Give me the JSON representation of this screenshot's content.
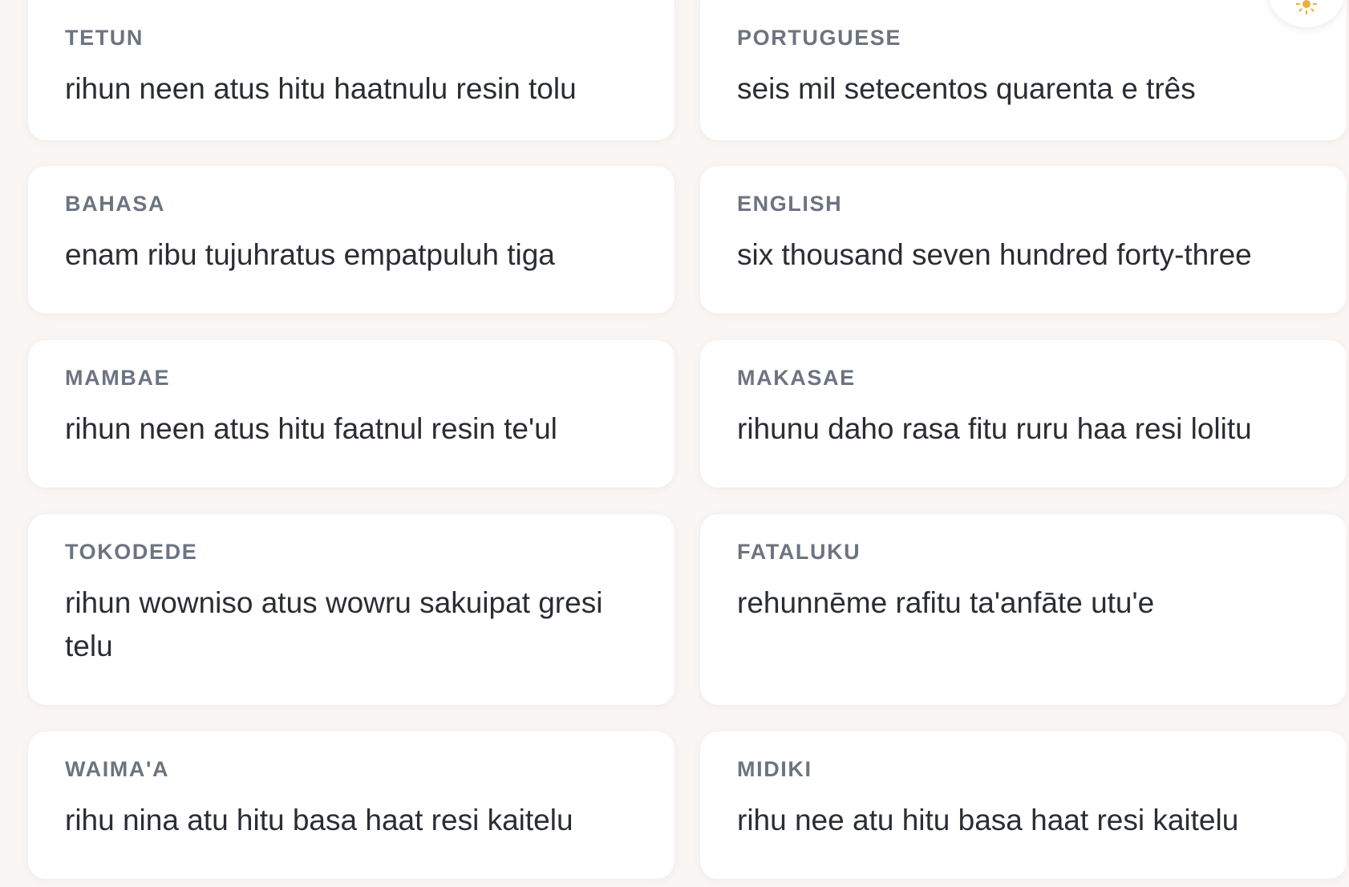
{
  "cards": [
    {
      "lang": "TETUN",
      "text": "rihun neen atus hitu haatnulu resin tolu"
    },
    {
      "lang": "PORTUGUESE",
      "text": "seis mil setecentos quarenta e três"
    },
    {
      "lang": "BAHASA",
      "text": "enam ribu tujuhratus empatpuluh tiga"
    },
    {
      "lang": "ENGLISH",
      "text": "six thousand seven hundred forty-three"
    },
    {
      "lang": "MAMBAE",
      "text": "rihun neen atus hitu faatnul resin te'ul"
    },
    {
      "lang": "MAKASAE",
      "text": "rihunu daho rasa fitu ruru haa resi lolitu"
    },
    {
      "lang": "TOKODEDE",
      "text": "rihun wowniso atus wowru sakuipat gresi telu"
    },
    {
      "lang": "FATALUKU",
      "text": "rehunnēme rafitu ta'anfāte utu'e"
    },
    {
      "lang": "WAIMA'A",
      "text": "rihu nina atu hitu basa haat resi kaitelu"
    },
    {
      "lang": "MIDIKI",
      "text": "rihu nee atu hitu basa haat resi kaitelu"
    }
  ],
  "theme_toggle": {
    "icon": "sun-icon",
    "color": "#e8b23c"
  },
  "colors": {
    "background": "#faf6f4",
    "card": "#ffffff",
    "label": "#6b7480",
    "text": "#2a2d33"
  }
}
